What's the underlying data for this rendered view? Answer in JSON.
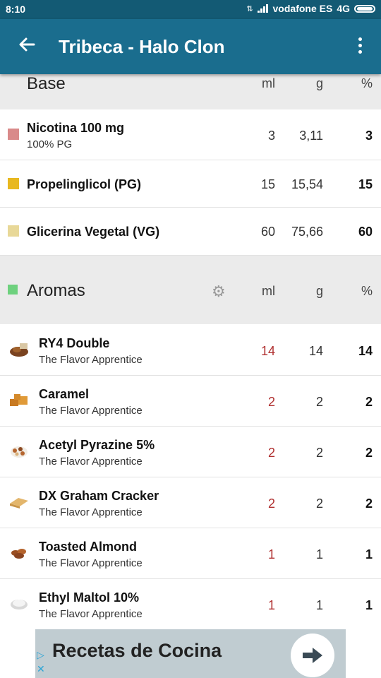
{
  "status_bar": {
    "time": "8:10",
    "carrier": "vodafone ES",
    "network": "4G"
  },
  "app_bar": {
    "title": "Tribeca - Halo Clon"
  },
  "columns": {
    "ml": "ml",
    "g": "g",
    "pct": "%"
  },
  "base": {
    "title": "Base",
    "rows": [
      {
        "name": "Nicotina 100 mg",
        "sub": "100% PG",
        "ml": "3",
        "g": "3,11",
        "pct": "3",
        "color": "#d98a8a"
      },
      {
        "name": "Propelinglicol (PG)",
        "sub": "",
        "ml": "15",
        "g": "15,54",
        "pct": "15",
        "color": "#e8b820"
      },
      {
        "name": "Glicerina Vegetal (VG)",
        "sub": "",
        "ml": "60",
        "g": "75,66",
        "pct": "60",
        "color": "#e8d898"
      }
    ]
  },
  "aromas": {
    "title": "Aromas",
    "color": "#6ed17e",
    "rows": [
      {
        "name": "RY4 Double",
        "sub": "The Flavor Apprentice",
        "ml": "14",
        "g": "14",
        "pct": "14",
        "icon": "tobacco-icon"
      },
      {
        "name": "Caramel",
        "sub": "The Flavor Apprentice",
        "ml": "2",
        "g": "2",
        "pct": "2",
        "icon": "caramel-icon"
      },
      {
        "name": "Acetyl Pyrazine 5%",
        "sub": "The Flavor Apprentice",
        "ml": "2",
        "g": "2",
        "pct": "2",
        "icon": "nuts-icon"
      },
      {
        "name": "DX Graham Cracker",
        "sub": "The Flavor Apprentice",
        "ml": "2",
        "g": "2",
        "pct": "2",
        "icon": "cracker-icon"
      },
      {
        "name": "Toasted Almond",
        "sub": "The Flavor Apprentice",
        "ml": "1",
        "g": "1",
        "pct": "1",
        "icon": "almond-icon"
      },
      {
        "name": "Ethyl Maltol 10%",
        "sub": "The Flavor Apprentice",
        "ml": "1",
        "g": "1",
        "pct": "1",
        "icon": "powder-icon"
      }
    ]
  },
  "ad": {
    "text": "Recetas de Cocina"
  }
}
